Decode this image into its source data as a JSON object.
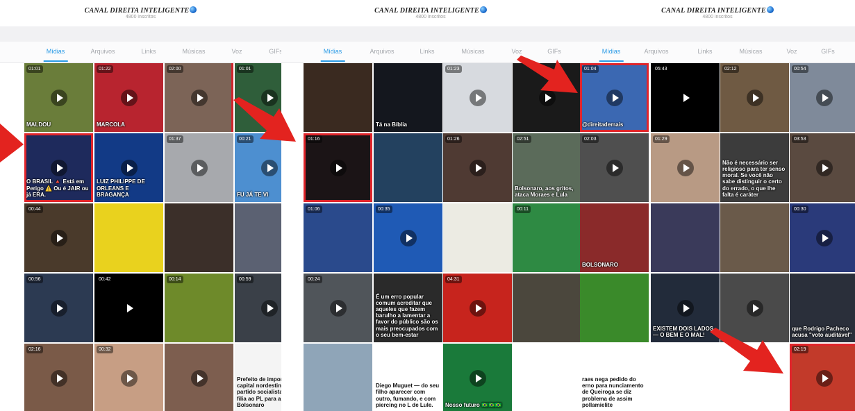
{
  "panels": [
    {
      "channel_name": "CANAL DIREITA INTELIGENTE",
      "subscribers": "4800 inscritos",
      "tabs": [
        "Mídias",
        "Arquivos",
        "Links",
        "Músicas",
        "Voz",
        "GIFs"
      ],
      "active_tab": "Mídias",
      "tiles": [
        [
          {
            "duration": "01:01",
            "label": "MALDOU",
            "bg": "#6a7d3a",
            "play": true
          },
          {
            "duration": "01:22",
            "label": "MARCOLA",
            "bg": "#b8242f",
            "play": true
          },
          {
            "duration": "02:00",
            "label": "",
            "bg": "#7c6457",
            "play": true,
            "red_edge": true
          },
          {
            "duration": "01:01",
            "label": "",
            "bg": "#2f5e3a",
            "play": true
          },
          {
            "duration": "",
            "label": "",
            "bg": "#5a5a55",
            "play": true
          }
        ],
        [
          {
            "duration": "",
            "label": "O BRASIL 🔺 Está em Perigo ⚠️ Ou é JAIR ou já ERA.",
            "bg": "#1e2a5c",
            "play": true,
            "highlight": true
          },
          {
            "duration": "",
            "label": "LUIZ PHILIPPE DE ORLEANS E BRAGANÇA",
            "bg": "#123a86",
            "play": true
          },
          {
            "duration": "01:37",
            "label": "",
            "bg": "#a7a9ad",
            "play": true
          },
          {
            "duration": "00:21",
            "label": "FU JÁ TE VI",
            "bg": "#4d8fd0",
            "play": true
          },
          {
            "duration": "",
            "label": "",
            "bg": "#8a7a62",
            "play": false
          }
        ],
        [
          {
            "duration": "00:44",
            "label": "",
            "bg": "#4a3a2b",
            "play": true
          },
          {
            "duration": "",
            "label": "",
            "bg": "#e9d21e",
            "play": false
          },
          {
            "duration": "",
            "label": "",
            "bg": "#3b2f29",
            "play": false
          },
          {
            "duration": "",
            "label": "",
            "bg": "#5b6172",
            "play": false
          },
          {
            "duration": "",
            "label": "",
            "bg": "#2a5a8a",
            "play": false
          }
        ],
        [
          {
            "duration": "00:56",
            "label": "",
            "bg": "#2c3a52",
            "play": true
          },
          {
            "duration": "00:42",
            "label": "",
            "bg": "#000000",
            "play": true
          },
          {
            "duration": "00:14",
            "label": "",
            "bg": "#6e8a2a",
            "play": false
          },
          {
            "duration": "00:59",
            "label": "",
            "bg": "#3a4048",
            "play": true
          },
          {
            "duration": "",
            "label": "",
            "bg": "#4b5257",
            "play": false
          }
        ],
        [
          {
            "duration": "02:16",
            "label": "",
            "bg": "#7a5a48",
            "play": true
          },
          {
            "duration": "00:32",
            "label": "",
            "bg": "#c79e84",
            "play": true
          },
          {
            "duration": "",
            "label": "",
            "bg": "#7d5e4f",
            "play": true
          },
          {
            "duration": "",
            "label": "Prefeito de importante capital nordestina deixa partido socialista e se filia ao PL para apoiar Bolsonaro",
            "bg": "#f4f4f4",
            "play": false,
            "dark_text": true
          },
          {
            "duration": "",
            "label": "",
            "bg": "#d9b04a",
            "play": false
          }
        ]
      ]
    },
    {
      "channel_name": "CANAL DIREITA INTELIGENTE",
      "subscribers": "4800 inscritos",
      "tabs": [
        "Mídias",
        "Arquivos",
        "Links",
        "Músicas",
        "Voz",
        "GIFs"
      ],
      "active_tab": "Mídias",
      "tiles": [
        [
          {
            "duration": "",
            "label": "",
            "bg": "#3a2a20",
            "play": false
          },
          {
            "duration": "",
            "label": "Tá na Bíblia",
            "bg": "#14171e",
            "play": false
          },
          {
            "duration": "01:23",
            "label": "",
            "bg": "#d7dadf",
            "play": true
          },
          {
            "duration": "",
            "label": "",
            "bg": "#1a1a1a",
            "play": true
          },
          {
            "duration": "",
            "label": "",
            "bg": "#f2f2f2",
            "play": false
          }
        ],
        [
          {
            "duration": "01:16",
            "label": "",
            "bg": "#1b1416",
            "play": true,
            "highlight": true
          },
          {
            "duration": "",
            "label": "",
            "bg": "#23415f",
            "play": false
          },
          {
            "duration": "01:26",
            "label": "",
            "bg": "#4f3a33",
            "play": true
          },
          {
            "duration": "02:51",
            "label": "Bolsonaro, aos gritos, ataca Moraes e Lula",
            "bg": "#5b6b5a",
            "play": false
          },
          {
            "duration": "",
            "label": "",
            "bg": "#ffffff",
            "play": false
          }
        ],
        [
          {
            "duration": "01:06",
            "label": "",
            "bg": "#2a4a8c",
            "play": false
          },
          {
            "duration": "00:35",
            "label": "",
            "bg": "#1f5ab5",
            "play": true
          },
          {
            "duration": "",
            "label": "",
            "bg": "#ecebe3",
            "play": false
          },
          {
            "duration": "00:11",
            "label": "",
            "bg": "#2e8a43",
            "play": false
          },
          {
            "duration": "",
            "label": "",
            "bg": "#ffffff",
            "play": false
          }
        ],
        [
          {
            "duration": "00:24",
            "label": "",
            "bg": "#50555a",
            "play": true
          },
          {
            "duration": "",
            "label": "É um erro popular comum acreditar que aqueles que fazem barulho a lamentar a favor do público são os mais preocupados com o seu bem-estar",
            "bg": "#2a2a2a",
            "play": false
          },
          {
            "duration": "04:31",
            "label": "",
            "bg": "#c7241d",
            "play": true
          },
          {
            "duration": "",
            "label": "",
            "bg": "#4b473d",
            "play": false
          },
          {
            "duration": "",
            "label": "",
            "bg": "#ffffff",
            "play": false
          }
        ],
        [
          {
            "duration": "",
            "label": "",
            "bg": "#8fa5b8",
            "play": false
          },
          {
            "duration": "",
            "label": "Diego Muguet — do seu filho aparecer com outro, fumando, e com piercing no L de Lule.",
            "bg": "#ffffff",
            "play": false,
            "dark_text": true
          },
          {
            "duration": "",
            "label": "Nosso futuro 🇧🇷🇧🇷🇧🇷",
            "bg": "#1a7a3a",
            "play": true
          },
          {
            "duration": "",
            "label": "",
            "bg": "#ffffff",
            "play": false
          },
          {
            "duration": "",
            "label": "",
            "bg": "#ffffff",
            "play": false
          }
        ]
      ]
    },
    {
      "channel_name": "CANAL DIREITA INTELIGENTE",
      "subscribers": "4800 inscritos",
      "tabs": [
        "Mídias",
        "Arquivos",
        "Links",
        "Músicas",
        "Voz",
        "GIFs"
      ],
      "active_tab": "Mídias",
      "tiles": [
        [
          {
            "duration": "01:04",
            "label": "@direitademais",
            "bg": "#3b68b2",
            "play": true,
            "highlight": true
          },
          {
            "duration": "05:43",
            "label": "",
            "bg": "#000000",
            "play": true
          },
          {
            "duration": "02:12",
            "label": "",
            "bg": "#6f5a43",
            "play": true
          },
          {
            "duration": "00:54",
            "label": "",
            "bg": "#7f8a9a",
            "play": true
          }
        ],
        [
          {
            "duration": "02:03",
            "label": "",
            "bg": "#4f4f4f",
            "play": true
          },
          {
            "duration": "01:29",
            "label": "",
            "bg": "#b89a84",
            "play": true
          },
          {
            "duration": "",
            "label": "Não é necessário ser religioso para ter senso moral. Se você não sabe distinguir o certo do errado, o que lhe falta é caráter",
            "bg": "#3c3c3c",
            "play": false
          },
          {
            "duration": "03:53",
            "label": "",
            "bg": "#5a4a40",
            "play": true
          }
        ],
        [
          {
            "duration": "",
            "label": "BOLSONARO",
            "bg": "#8a2a2a",
            "play": false
          },
          {
            "duration": "",
            "label": "",
            "bg": "#3a3a5a",
            "play": false
          },
          {
            "duration": "",
            "label": "",
            "bg": "#6a5a4a",
            "play": false
          },
          {
            "duration": "00:30",
            "label": "",
            "bg": "#2a3a7a",
            "play": true
          }
        ],
        [
          {
            "duration": "",
            "label": "",
            "bg": "#3a8a2a",
            "play": false
          },
          {
            "duration": "",
            "label": "EXISTEM DOIS LADOS — O BEM E O MAL!",
            "bg": "#222b3a",
            "play": true
          },
          {
            "duration": "",
            "label": "",
            "bg": "#4a4a4a",
            "play": true
          },
          {
            "duration": "",
            "label": "que Rodrigo Pacheco acusa \"voto auditável\"",
            "bg": "#2a2f3a",
            "play": false
          }
        ],
        [
          {
            "duration": "",
            "label": "raes nega pedido do erno para nunciamento de Queiroga se diz problema de assim pollamielite",
            "bg": "#ffffff",
            "play": false,
            "dark_text": true
          },
          {
            "duration": "",
            "label": "",
            "bg": "#ffffff",
            "play": false
          },
          {
            "duration": "",
            "label": "",
            "bg": "#ffffff",
            "play": false
          },
          {
            "duration": "02:19",
            "label": "",
            "bg": "#c23a2a",
            "play": true,
            "highlight": true
          }
        ]
      ]
    }
  ],
  "annotations": [
    "arrow-1",
    "arrow-2",
    "arrow-3",
    "arrow-4"
  ],
  "colors": {
    "accent": "#2b9be6",
    "highlight": "#e0252b",
    "arrow": "#e3231f"
  }
}
